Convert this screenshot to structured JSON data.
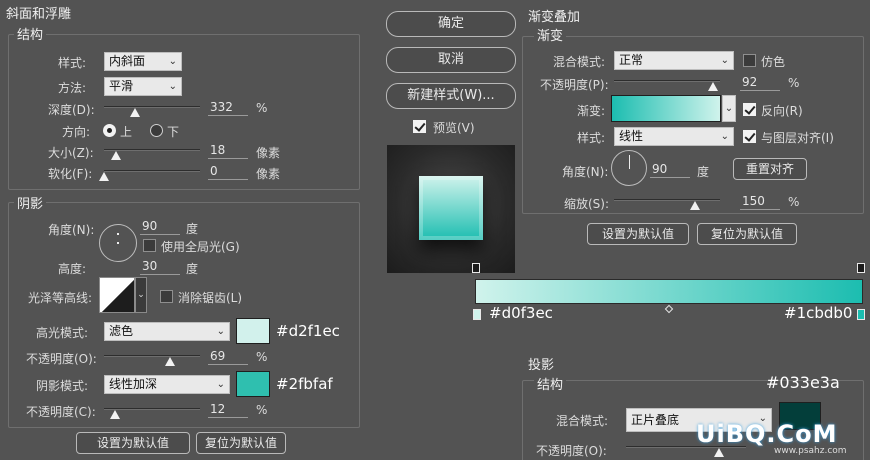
{
  "bevel": {
    "title": "斜面和浮雕",
    "structure": {
      "title": "结构",
      "style_label": "样式:",
      "style_value": "内斜面",
      "technique_label": "方法:",
      "technique_value": "平滑",
      "depth_label": "深度(D):",
      "depth_value": "332",
      "depth_unit": "%",
      "depth_fraction": 0.33,
      "direction_label": "方向:",
      "direction_up": "上",
      "direction_down": "下",
      "size_label": "大小(Z):",
      "size_value": "18",
      "size_unit": "像素",
      "size_fraction": 0.07,
      "soften_label": "软化(F):",
      "soften_value": "0",
      "soften_unit": "像素",
      "soften_fraction": 0.0
    },
    "shading": {
      "title": "阴影",
      "angle_label": "角度(N):",
      "angle_value": "90",
      "angle_unit": "度",
      "global_light_label": "使用全局光(G)",
      "altitude_label": "高度:",
      "altitude_value": "30",
      "altitude_unit": "度",
      "gloss_label": "光泽等高线:",
      "antialias_label": "消除锯齿(L)",
      "highlight_label": "高光模式:",
      "highlight_mode": "滤色",
      "highlight_color": "#d2f1ec",
      "highlight_hex": "#d2f1ec",
      "highlight_opacity_label": "不透明度(O):",
      "highlight_opacity_value": "69",
      "highlight_opacity_unit": "%",
      "highlight_opacity_fraction": 0.69,
      "shadow_label": "阴影模式:",
      "shadow_mode": "线性加深",
      "shadow_color": "#2fbfaf",
      "shadow_hex": "#2fbfaf",
      "shadow_opacity_label": "不透明度(C):",
      "shadow_opacity_value": "12",
      "shadow_opacity_unit": "%",
      "shadow_opacity_fraction": 0.12
    },
    "btn_default": "设置为默认值",
    "btn_reset": "复位为默认值"
  },
  "middle": {
    "ok": "确定",
    "cancel": "取消",
    "new_style": "新建样式(W)...",
    "preview_label": "预览(V)"
  },
  "gradient_overlay": {
    "title": "渐变叠加",
    "section": "渐变",
    "blend_label": "混合模式:",
    "blend_value": "正常",
    "dither_label": "仿色",
    "opacity_label": "不透明度(P):",
    "opacity_value": "92",
    "opacity_unit": "%",
    "opacity_fraction": 0.92,
    "gradient_label": "渐变:",
    "reverse_label": "反向(R)",
    "style_label": "样式:",
    "style_value": "线性",
    "align_label": "与图层对齐(I)",
    "angle_label": "角度(N):",
    "angle_value": "90",
    "angle_unit": "度",
    "reset_align": "重置对齐",
    "scale_label": "缩放(S):",
    "scale_value": "150",
    "scale_unit": "%",
    "scale_fraction": 0.75,
    "btn_default": "设置为默认值",
    "btn_reset": "复位为默认值",
    "color_start": "#d0f3ec",
    "color_end": "#1cbdb0",
    "start_hex": "#d0f3ec",
    "end_hex": "#1cbdb0"
  },
  "drop_shadow": {
    "title": "投影",
    "section": "结构",
    "color": "#033e3a",
    "color_hex": "#033e3a",
    "blend_label": "混合模式:",
    "blend_value": "正片叠底",
    "opacity_label": "不透明度(O):"
  },
  "watermark": {
    "text": "UiBQ.CoM",
    "sub": "www.psahz.com"
  }
}
